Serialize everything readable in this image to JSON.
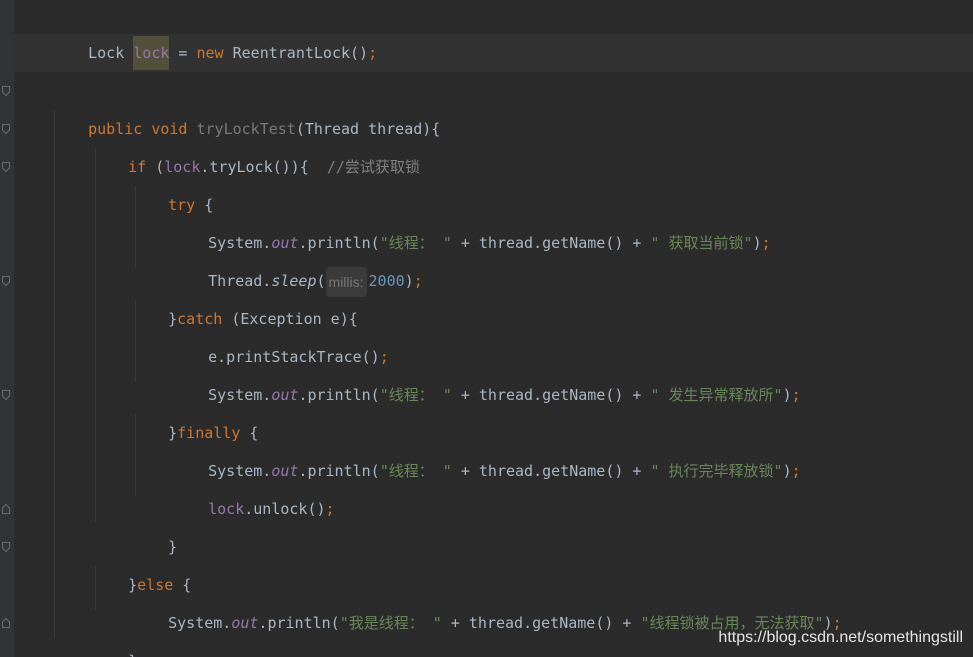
{
  "code": {
    "l1": {
      "t1": "Lock ",
      "t2": "lock",
      "t3": " = ",
      "t4": "new",
      "t5": " ReentrantLock()",
      "t6": ";"
    },
    "l2": {
      "t1": "public",
      "t2": " ",
      "t3": "void",
      "t4": " ",
      "t5": "tryLockTest",
      "t6": "(Thread thread){"
    },
    "l3": {
      "t1": "if",
      "t2": " (",
      "t3": "lock",
      "t4": ".tryLock()){  ",
      "t5": "//尝试获取锁"
    },
    "l4": {
      "t1": "try",
      "t2": " {"
    },
    "l5": {
      "t1": "System.",
      "t2": "out",
      "t3": ".println(",
      "t4": "\"线程： \"",
      "t5": " + thread.getName() + ",
      "t6": "\" 获取当前锁\"",
      "t7": ")",
      "t8": ";"
    },
    "l6": {
      "t1": "Thread.",
      "t2": "sleep",
      "t3": "(",
      "hint": "millis:",
      "t4": "2000",
      "t5": ")",
      "t6": ";"
    },
    "l7": {
      "t1": "}",
      "t2": "catch",
      "t3": " (Exception e){"
    },
    "l8": {
      "t1": "e.printStackTrace()",
      "t2": ";"
    },
    "l9": {
      "t1": "System.",
      "t2": "out",
      "t3": ".println(",
      "t4": "\"线程： \"",
      "t5": " + thread.getName() + ",
      "t6": "\" 发生异常释放所\"",
      "t7": ")",
      "t8": ";"
    },
    "l10": {
      "t1": "}",
      "t2": "finally",
      "t3": " {"
    },
    "l11": {
      "t1": "System.",
      "t2": "out",
      "t3": ".println(",
      "t4": "\"线程： \"",
      "t5": " + thread.getName() + ",
      "t6": "\" 执行完毕释放锁\"",
      "t7": ")",
      "t8": ";"
    },
    "l12": {
      "t1": "lock",
      "t2": ".unlock()",
      "t3": ";"
    },
    "l13": {
      "t1": "}"
    },
    "l14": {
      "t1": "}",
      "t2": "else",
      "t3": " {"
    },
    "l15": {
      "t1": "System.",
      "t2": "out",
      "t3": ".println(",
      "t4": "\"我是线程： \"",
      "t5": " + thread.getName() + ",
      "t6": "\"线程锁被占用，无法获取\"",
      "t7": ")",
      "t8": ";"
    },
    "l16": {
      "t1": "}"
    }
  },
  "watermark": "https://blog.csdn.net/somethingstill",
  "colors": {
    "background": "#2b2b2b",
    "keyword": "#cc7832",
    "string": "#6a8759",
    "number": "#6897bb",
    "field": "#9876aa",
    "comment": "#808080",
    "text": "#a9b7c6"
  }
}
